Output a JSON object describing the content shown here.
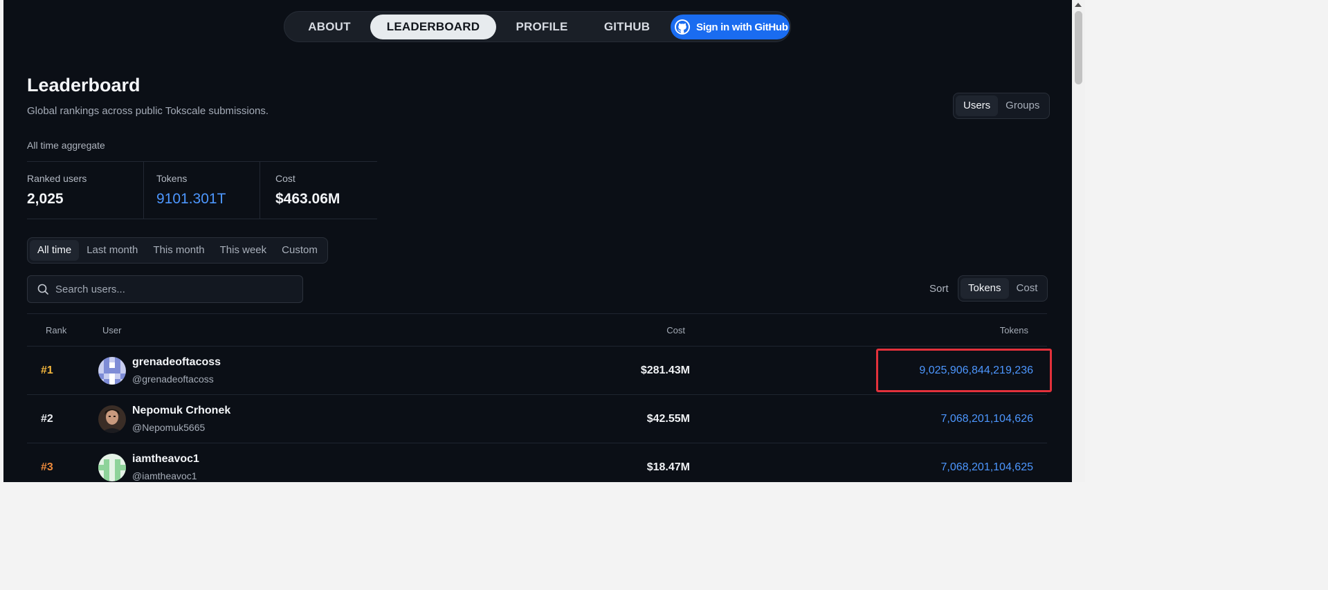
{
  "nav": {
    "items": [
      {
        "label": "ABOUT",
        "active": false
      },
      {
        "label": "LEADERBOARD",
        "active": true
      },
      {
        "label": "PROFILE",
        "active": false
      },
      {
        "label": "GITHUB",
        "active": false
      }
    ],
    "signin_label": "Sign in with GitHub"
  },
  "page": {
    "title": "Leaderboard",
    "subtitle": "Global rankings across public Tokscale submissions."
  },
  "scope_toggle": {
    "users": "Users",
    "groups": "Groups",
    "selected": "Users"
  },
  "aggregate_label": "All time aggregate",
  "stats": [
    {
      "label": "Ranked users",
      "value": "2,025"
    },
    {
      "label": "Tokens",
      "value": "9101.301T"
    },
    {
      "label": "Cost",
      "value": "$463.06M"
    }
  ],
  "periods": [
    "All time",
    "Last month",
    "This month",
    "This week",
    "Custom"
  ],
  "selected_period": "All time",
  "search": {
    "placeholder": "Search users..."
  },
  "sort": {
    "label": "Sort",
    "options": [
      "Tokens",
      "Cost"
    ],
    "selected": "Tokens"
  },
  "table": {
    "headers": {
      "rank": "Rank",
      "user": "User",
      "cost": "Cost",
      "tokens": "Tokens"
    },
    "rows": [
      {
        "rank": "#1",
        "name": "grenadeoftacoss",
        "handle": "@grenadeoftacoss",
        "cost": "$281.43M",
        "tokens": "9,025,906,844,219,236"
      },
      {
        "rank": "#2",
        "name": "Nepomuk Crhonek",
        "handle": "@Nepomuk5665",
        "cost": "$42.55M",
        "tokens": "7,068,201,104,626"
      },
      {
        "rank": "#3",
        "name": "iamtheavoc1",
        "handle": "@iamtheavoc1",
        "cost": "$18.47M",
        "tokens": "7,068,201,104,625"
      }
    ]
  },
  "colors": {
    "background": "#0b0f16",
    "accent": "#1a6cf0",
    "token_blue": "#4d97ff",
    "rank_gold": "#f5b83d",
    "rank_bronze": "#ee8a3c",
    "highlight_red": "#e3313b"
  },
  "icons": {
    "search": "search-icon",
    "github": "github-icon"
  }
}
